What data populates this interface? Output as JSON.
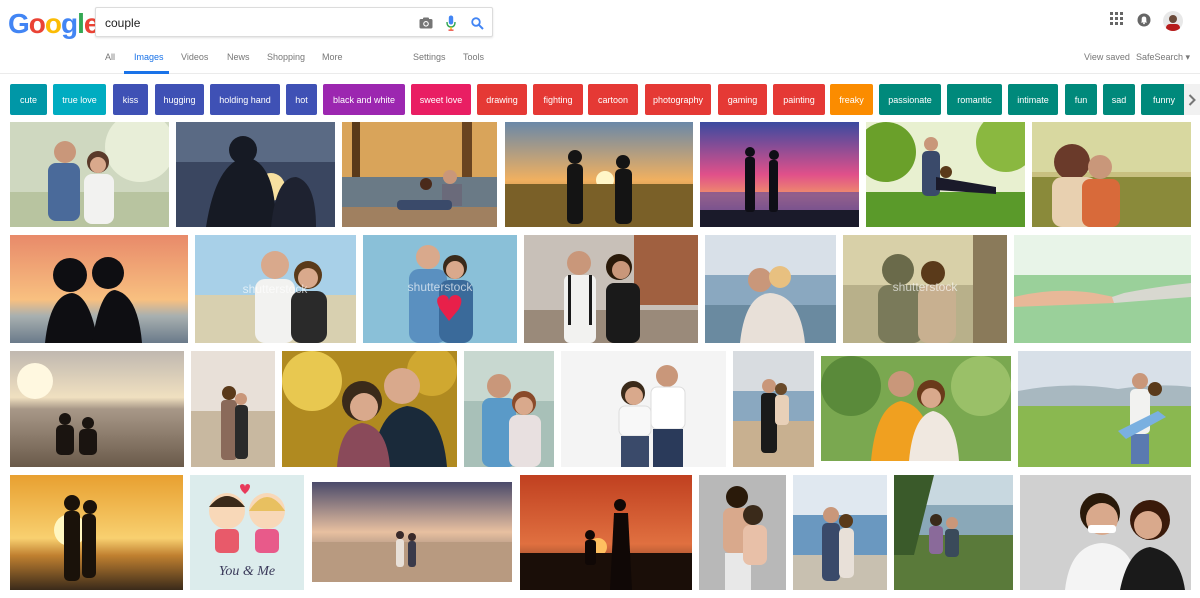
{
  "search": {
    "query": "couple"
  },
  "logo": {
    "letters": [
      "G",
      "o",
      "o",
      "g",
      "l",
      "e"
    ],
    "colors": [
      "#4285f4",
      "#ea4335",
      "#fbbc05",
      "#4285f4",
      "#34a853",
      "#ea4335"
    ]
  },
  "nav": {
    "items": [
      {
        "label": "All",
        "active": false
      },
      {
        "label": "Images",
        "active": true
      },
      {
        "label": "Videos",
        "active": false
      },
      {
        "label": "News",
        "active": false
      },
      {
        "label": "Shopping",
        "active": false
      },
      {
        "label": "More",
        "active": false
      },
      {
        "label": "Settings",
        "active": false
      },
      {
        "label": "Tools",
        "active": false
      }
    ],
    "view_saved": "View saved",
    "safesearch": "SafeSearch ▾"
  },
  "chips": [
    {
      "label": "cute",
      "color": "#0097a7"
    },
    {
      "label": "true love",
      "color": "#00acc1"
    },
    {
      "label": "kiss",
      "color": "#3f51b5"
    },
    {
      "label": "hugging",
      "color": "#3f51b5"
    },
    {
      "label": "holding hand",
      "color": "#3f51b5"
    },
    {
      "label": "hot",
      "color": "#3f51b5"
    },
    {
      "label": "black and white",
      "color": "#9c27b0"
    },
    {
      "label": "sweet love",
      "color": "#e91e63"
    },
    {
      "label": "drawing",
      "color": "#e53935"
    },
    {
      "label": "fighting",
      "color": "#e53935"
    },
    {
      "label": "cartoon",
      "color": "#e53935"
    },
    {
      "label": "photography",
      "color": "#e53935"
    },
    {
      "label": "gaming",
      "color": "#e53935"
    },
    {
      "label": "painting",
      "color": "#e53935"
    },
    {
      "label": "freaky",
      "color": "#fb8c00"
    },
    {
      "label": "passionate",
      "color": "#00897b"
    },
    {
      "label": "romantic",
      "color": "#00897b"
    },
    {
      "label": "intimate",
      "color": "#00897b"
    },
    {
      "label": "fun",
      "color": "#00897b"
    },
    {
      "label": "sad",
      "color": "#00897b"
    },
    {
      "label": "funny",
      "color": "#00897b"
    }
  ],
  "images": {
    "watermark": "shutterstock",
    "cartoon_caption": "You & Me"
  },
  "colors": {
    "accent": "#1a73e8",
    "nav_text": "#777777"
  }
}
